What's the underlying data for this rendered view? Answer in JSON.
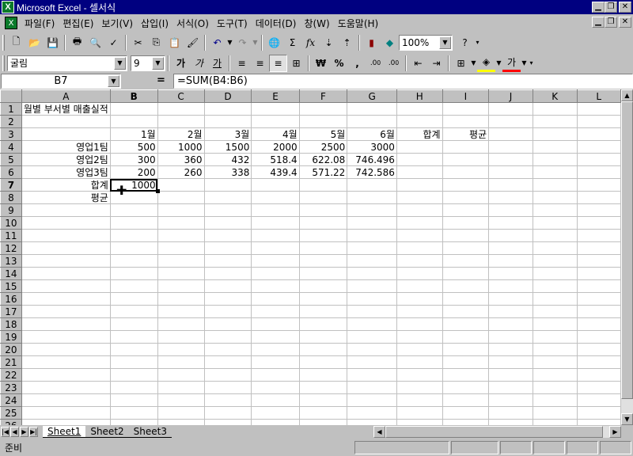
{
  "window": {
    "title": "Microsoft Excel - 셀서식"
  },
  "menu": [
    "파일(F)",
    "편집(E)",
    "보기(V)",
    "삽입(I)",
    "서식(O)",
    "도구(T)",
    "데이터(D)",
    "창(W)",
    "도움말(H)"
  ],
  "toolbar": {
    "zoom": "100%"
  },
  "format": {
    "font": "굴림",
    "size": "9"
  },
  "formula_bar": {
    "name_box": "B7",
    "equals": "=",
    "formula": "=SUM(B4:B6)"
  },
  "columns": [
    "A",
    "B",
    "C",
    "D",
    "E",
    "F",
    "G",
    "H",
    "I",
    "J",
    "K",
    "L"
  ],
  "cells": {
    "A1": "월별 부서별 매출실적",
    "B3": "1월",
    "C3": "2월",
    "D3": "3월",
    "E3": "4월",
    "F3": "5월",
    "G3": "6월",
    "H3": "합계",
    "I3": "평균",
    "A4": "영업1팀",
    "B4": "500",
    "C4": "1000",
    "D4": "1500",
    "E4": "2000",
    "F4": "2500",
    "G4": "3000",
    "A5": "영업2팀",
    "B5": "300",
    "C5": "360",
    "D5": "432",
    "E5": "518.4",
    "F5": "622.08",
    "G5": "746.496",
    "A6": "영업3팀",
    "B6": "200",
    "C6": "260",
    "D6": "338",
    "E6": "439.4",
    "F6": "571.22",
    "G6": "742.586",
    "A7": "합계",
    "B7": "1000",
    "A8": "평균"
  },
  "sheets": [
    "Sheet1",
    "Sheet2",
    "Sheet3"
  ],
  "status": "준비",
  "colors": {
    "title_bar": "#000080",
    "chrome": "#c0c0c0"
  }
}
